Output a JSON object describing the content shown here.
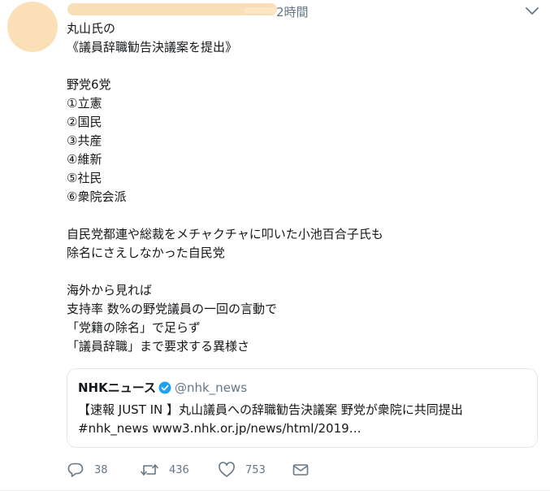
{
  "tweet": {
    "time": "2時間",
    "body": "丸山氏の\n《議員辞職勧告決議案を提出》\n\n野党6党\n①立憲\n②国民\n③共産\n④維新\n⑤社民\n⑥衆院会派\n\n自民党都連や総裁をメチャクチャに叩いた小池百合子氏も\n除名にさえしなかった自民党\n\n海外から見れば\n支持率 数%の野党議員の一回の言動で\n「党籍の除名」で足らず\n「議員辞職」まで要求する異様さ"
  },
  "quote": {
    "name": "NHKニュース",
    "handle": "@nhk_news",
    "text": "【速報 JUST IN 】丸山議員への辞職勧告決議案 野党が衆院に共同提出 #nhk_news www3.nhk.or.jp/news/html/2019…"
  },
  "actions": {
    "replies": "38",
    "retweets": "436",
    "likes": "753"
  }
}
